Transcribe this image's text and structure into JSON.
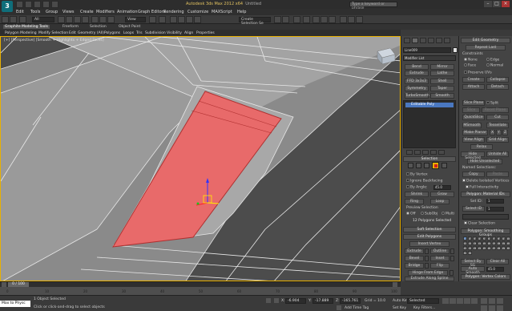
{
  "title_bar": {
    "title": "Autodesk 3ds Max 2012 x64",
    "file": "Untitled",
    "search_placeholder": "Type a keyword or phrase"
  },
  "menu": [
    "Edit",
    "Tools",
    "Group",
    "Views",
    "Create",
    "Modifiers",
    "Animation",
    "Graph Editors",
    "Rendering",
    "Customize",
    "MAXScript",
    "Help"
  ],
  "toolbar": {
    "filter": "All",
    "ref_coord": "View",
    "selection_set": "Create Selection Se"
  },
  "ribbon": {
    "tabs": [
      "Graphite Modeling Tools",
      "Freeform",
      "Selection",
      "Object Paint"
    ],
    "sub": [
      "Polygon Modeling",
      "Modify Selection",
      "Edit",
      "Geometry (All)",
      "Polygons",
      "Loops",
      "Tris",
      "Subdivision",
      "Visibility",
      "Align",
      "Properties"
    ]
  },
  "viewport": {
    "label": "[+] [Perspective] [Smooth + Highlights + Edged Faces]"
  },
  "command_panel": {
    "object_name": "Line009",
    "modifier_list": "Modifier List",
    "mod_buttons": [
      "Bend",
      "Mirror",
      "Extrude",
      "Lathe",
      "FFD 3x3x3",
      "Shell",
      "Symmetry",
      "Taper",
      "TurboSmooth",
      "Smooth"
    ],
    "stack_item": "Editable Poly",
    "selection": {
      "header": "Selection",
      "by_vertex": "By Vertex",
      "ignore_backfacing": "Ignore Backfacing",
      "by_angle": "By Angle:",
      "angle_value": "45.0",
      "shrink": "Shrink",
      "grow": "Grow",
      "ring": "Ring",
      "loop": "Loop",
      "preview": "Preview Selection",
      "off": "Off",
      "subobj": "SubObj",
      "multi": "Multi",
      "status": "12 Polygons Selected"
    },
    "soft_selection": "Soft Selection",
    "edit_polygons": {
      "header": "Edit Polygons",
      "insert_vertex": "Insert Vertex",
      "buttons": [
        "Extrude",
        "Outline",
        "Bevel",
        "Inset",
        "Bridge",
        "Flip"
      ],
      "hinge": "Hinge From Edge",
      "extrude_spline": "Extrude Along Spline",
      "edit_tri": "Edit Triangulation",
      "retriangulate": "Retriangulate",
      "turn": "Turn"
    }
  },
  "rollout": {
    "edit_geometry": "Edit Geometry",
    "repeat_last": "Repeat Last",
    "constraints": "Constraints",
    "none": "None",
    "edge": "Edge",
    "face": "Face",
    "normal": "Normal",
    "preserve_uvs": "Preserve UVs",
    "create": "Create",
    "collapse": "Collapse",
    "attach": "Attach",
    "detach": "Detach",
    "slice_plane": "Slice Plane",
    "split": "Split",
    "slice": "Slice",
    "reset_plane": "Reset Plane",
    "quickslice": "QuickSlice",
    "cut": "Cut",
    "msmooth": "MSmooth",
    "tessellate": "Tessellate",
    "make_planar": "Make Planar",
    "x": "X",
    "y": "Y",
    "z": "Z",
    "view_align": "View Align",
    "grid_align": "Grid Align",
    "relax": "Relax",
    "hide_selected": "Hide Selected",
    "unhide_all": "Unhide All",
    "hide_unselected": "Hide Unselected",
    "named_selections": "Named Selections:",
    "copy": "Copy",
    "paste": "Paste",
    "delete_isolated": "Delete Isolated Vertices",
    "full_interactivity": "Full Interactivity",
    "material_ids": "Polygon: Material IDs",
    "set_id": "Set ID:",
    "set_id_value": "1",
    "select_id": "Select ID",
    "select_id_value": "1",
    "clear_selection": "Clear Selection",
    "smoothing_groups": "Polygon: Smoothing Groups",
    "sg_numbers": [
      "1",
      "2",
      "3",
      "4",
      "5",
      "6",
      "7",
      "8",
      "9",
      "10",
      "11",
      "12",
      "13",
      "14",
      "15",
      "16",
      "17",
      "18",
      "19",
      "20",
      "21",
      "22",
      "23",
      "24",
      "25",
      "26",
      "27",
      "28",
      "29",
      "30",
      "31",
      "32"
    ],
    "select_by_sg": "Select By SG",
    "clear_all": "Clear All",
    "auto_smooth": "Auto Smooth",
    "auto_smooth_value": "45.0",
    "vertex_colors": "Polygon: Vertex Colors",
    "color": "Color:"
  },
  "timeline": {
    "frame": "0 / 100",
    "ticks": [
      "0",
      "10",
      "20",
      "30",
      "40",
      "50",
      "60",
      "70",
      "80",
      "90",
      "100"
    ]
  },
  "status": {
    "listener": "Max to Physc",
    "line1": "1 Object Selected",
    "line2": "Click or click-and-drag to select objects",
    "x_label": "X:",
    "x": "-6.904",
    "y_label": "Y:",
    "y": "-17.889",
    "z_label": "Z:",
    "z": "-165.761",
    "grid": "Grid = 10.0",
    "add_time_tag": "Add Time Tag",
    "auto_key": "Auto Key",
    "selected": "Selected",
    "set_key": "Set Key",
    "key_filters": "Key Filters..."
  },
  "colors": {
    "selection_red": "#e86a6a",
    "highlight_yellow": "#e8b000",
    "accent_blue": "#5a7fb0"
  }
}
